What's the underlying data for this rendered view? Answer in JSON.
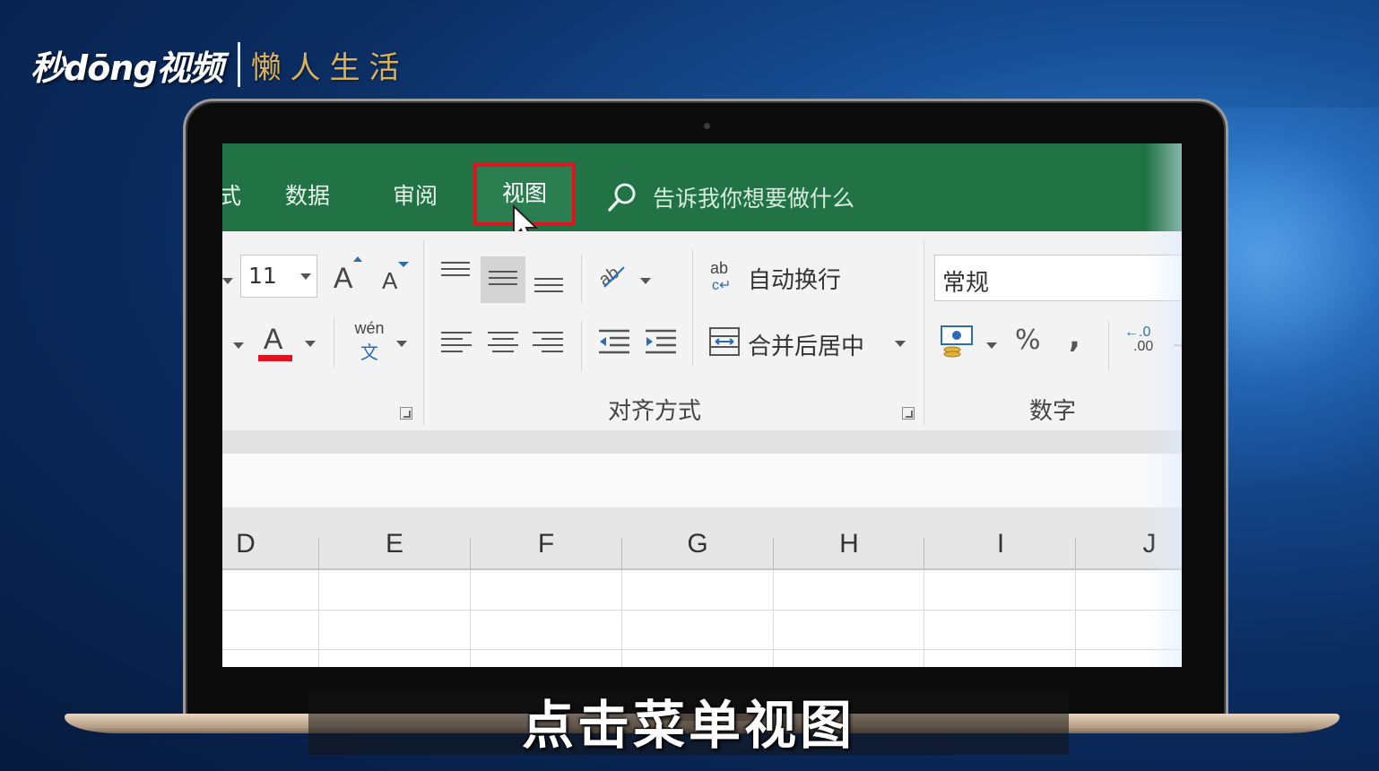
{
  "brand": {
    "logo_text": "秒dōng视频",
    "sub_text": "懒人生活"
  },
  "excel": {
    "tabs": {
      "cut_tab": "式",
      "data": "数据",
      "review": "审阅",
      "view": "视图"
    },
    "tell_me": "告诉我你想要做什么",
    "font": {
      "size": "11",
      "grow_label": "A",
      "shrink_label": "A",
      "color_label": "A",
      "phonetic_top": "wén",
      "phonetic_bottom": "文"
    },
    "alignment": {
      "wrap_icon": "ab",
      "wrap_text": "自动换行",
      "merge_center": "合并后居中",
      "group_label": "对齐方式"
    },
    "number": {
      "format": "常规",
      "percent": "%",
      "comma": ",",
      "decimal_top": "←.0",
      "decimal_bottom": ".00",
      "group_label": "数字"
    },
    "columns": [
      "D",
      "E",
      "F",
      "G",
      "H",
      "I",
      "J"
    ]
  },
  "subtitle": "点击菜单视图",
  "colors": {
    "excel_green": "#217346",
    "highlight_red": "#e0141f",
    "font_color_red": "#e0141f"
  }
}
